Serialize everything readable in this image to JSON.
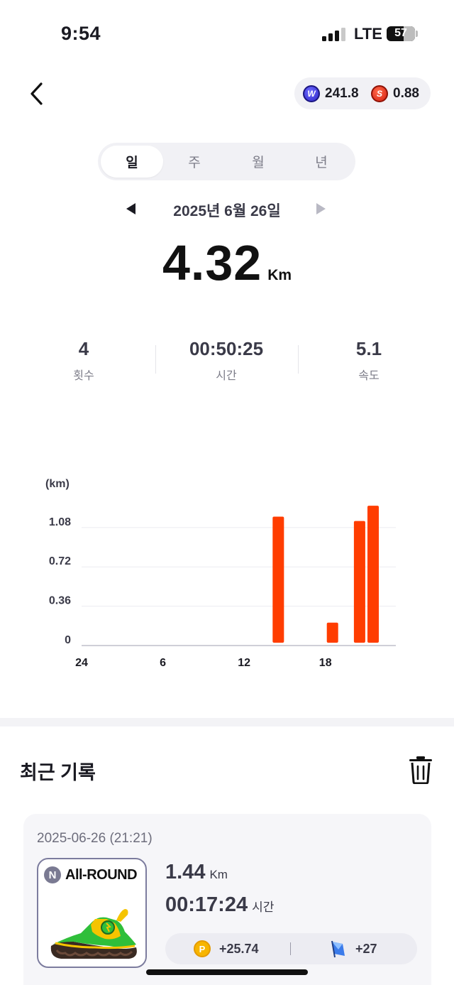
{
  "status_bar": {
    "time": "9:54",
    "network": "LTE",
    "battery": "57"
  },
  "tokens": [
    {
      "icon": "w-token-icon",
      "letter": "W",
      "value": "241.8",
      "color": "#3a33d6"
    },
    {
      "icon": "s-token-icon",
      "letter": "S",
      "value": "0.88",
      "color": "#e0321c"
    }
  ],
  "tabs": [
    {
      "label": "일",
      "active": true
    },
    {
      "label": "주",
      "active": false
    },
    {
      "label": "월",
      "active": false
    },
    {
      "label": "년",
      "active": false
    }
  ],
  "date": "2025년 6월 26일",
  "distance": {
    "value": "4.32",
    "unit": "Km"
  },
  "stats": [
    {
      "value": "4",
      "label": "횟수"
    },
    {
      "value": "00:50:25",
      "label": "시간"
    },
    {
      "value": "5.1",
      "label": "속도"
    }
  ],
  "chart_data": {
    "type": "bar",
    "ylabel": "(km)",
    "yticks": [
      "1.08",
      "0.72",
      "0.36",
      "0"
    ],
    "ytick_values": [
      1.08,
      0.72,
      0.36,
      0
    ],
    "ylim": [
      0,
      1.3
    ],
    "xticks": [
      "24",
      "6",
      "12",
      "18"
    ],
    "xtick_hours": [
      0,
      6,
      12,
      18
    ],
    "hours": [
      14,
      18,
      20,
      21
    ],
    "values": [
      1.18,
      0.21,
      1.14,
      1.28
    ],
    "bar_color": "#ff3d00",
    "grid": true
  },
  "recent": {
    "title": "최근 기록",
    "records": [
      {
        "datetime": "2025-06-26 (21:21)",
        "shoe_badge": "N",
        "shoe_name": "All-ROUND",
        "distance": "1.44",
        "distance_unit": "Km",
        "time": "00:17:24",
        "time_unit": "시간",
        "reward_p_icon": "P",
        "reward_p": "+25.74",
        "reward_flag": "+27"
      }
    ]
  },
  "colors": {
    "accent": "#ff3d00",
    "text": "#1a1a22",
    "muted": "#7c7c88"
  }
}
